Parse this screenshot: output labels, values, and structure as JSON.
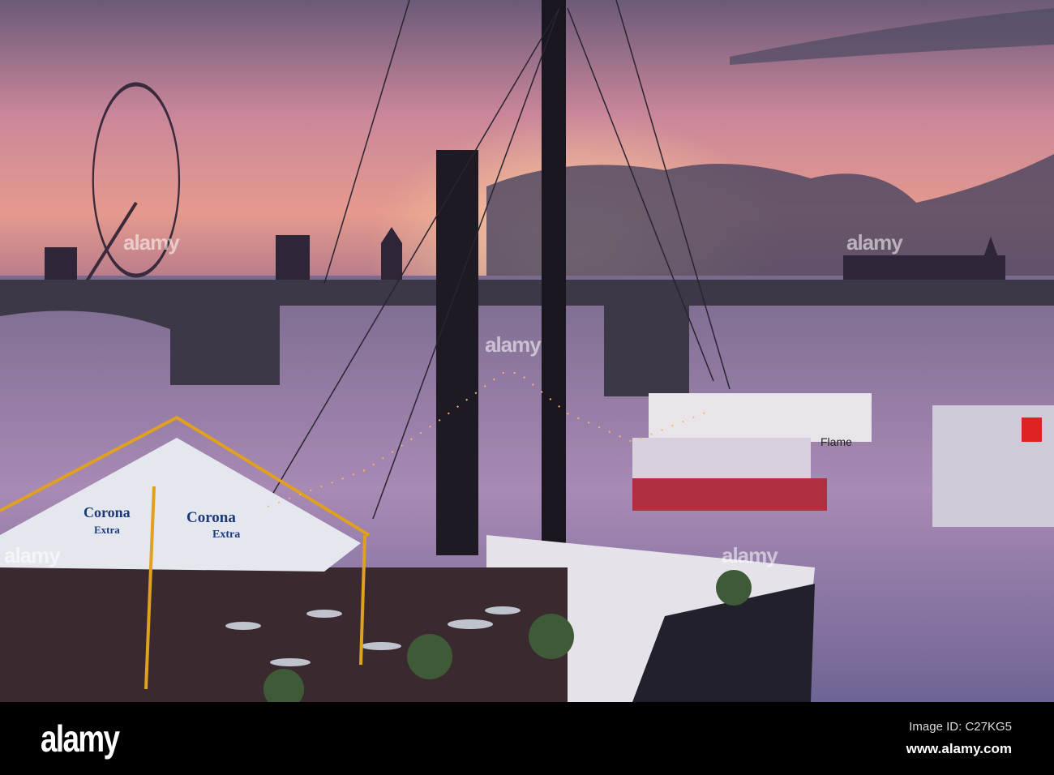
{
  "photo": {
    "tent_brand": "Corona",
    "tent_sub": "Extra",
    "boat_name": "Flame"
  },
  "watermark": "alamy",
  "footer": {
    "logo": "alamy",
    "image_id": "Image ID: C27KG5",
    "site": "www.alamy.com"
  }
}
